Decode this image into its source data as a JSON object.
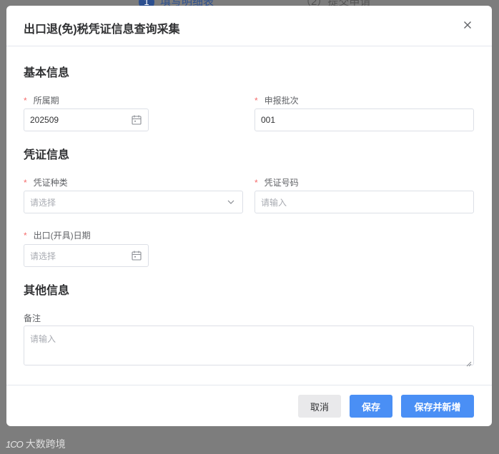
{
  "background": {
    "step1_num": "1",
    "step1_label": "填写明细表",
    "step2_label": "（2）提交申请"
  },
  "watermark": {
    "icon_text": "1CO",
    "text": "大数跨境"
  },
  "modal": {
    "title": "出口退(免)税凭证信息查询采集",
    "close_icon": "×"
  },
  "sections": {
    "basic": "基本信息",
    "voucher": "凭证信息",
    "other": "其他信息"
  },
  "fields": {
    "period": {
      "label": "所属期",
      "value": "202509",
      "required": true
    },
    "batch": {
      "label": "申报批次",
      "value": "001",
      "required": true
    },
    "voucher_type": {
      "label": "凭证种类",
      "placeholder": "请选择",
      "required": true
    },
    "voucher_no": {
      "label": "凭证号码",
      "placeholder": "请输入",
      "required": true
    },
    "export_date": {
      "label": "出口(开具)日期",
      "placeholder": "请选择",
      "required": true
    },
    "remark": {
      "label": "备注",
      "placeholder": "请输入",
      "required": false
    }
  },
  "required_mark": "*",
  "buttons": {
    "cancel": "取消",
    "save": "保存",
    "save_and_new": "保存并新增"
  },
  "colors": {
    "primary": "#4a8ff5",
    "required": "#f56c6c",
    "overlay": "#7d7d7d"
  }
}
